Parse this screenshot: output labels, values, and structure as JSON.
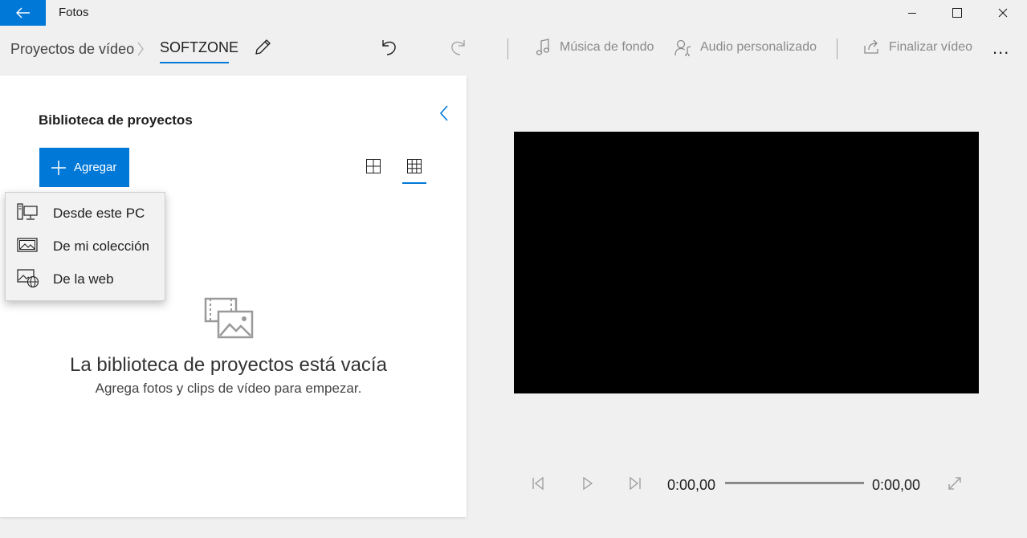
{
  "window": {
    "app_title": "Fotos",
    "icons": {
      "back": "back-arrow-icon",
      "minimize": "minimize-icon",
      "maximize": "maximize-icon",
      "close": "close-icon"
    },
    "accent_color": "#0078d7"
  },
  "breadcrumb": {
    "root": "Proyectos de vídeo",
    "current": "SOFTZONE"
  },
  "toolbar": {
    "music_label": "Música de fondo",
    "audio_label": "Audio personalizado",
    "finish_label": "Finalizar vídeo",
    "more_label": "..."
  },
  "library": {
    "title": "Biblioteca de proyectos",
    "add_label": "Agregar",
    "empty_title": "La biblioteca de proyectos está vacía",
    "empty_subtitle": "Agrega fotos y clips de vídeo para empezar."
  },
  "add_menu": {
    "items": [
      {
        "label": "Desde este PC",
        "icon": "computer-icon"
      },
      {
        "label": "De mi colección",
        "icon": "photo-collection-icon"
      },
      {
        "label": "De la web",
        "icon": "web-image-icon"
      }
    ]
  },
  "player": {
    "current_time": "0:00,00",
    "total_time": "0:00,00",
    "progress": 0
  }
}
